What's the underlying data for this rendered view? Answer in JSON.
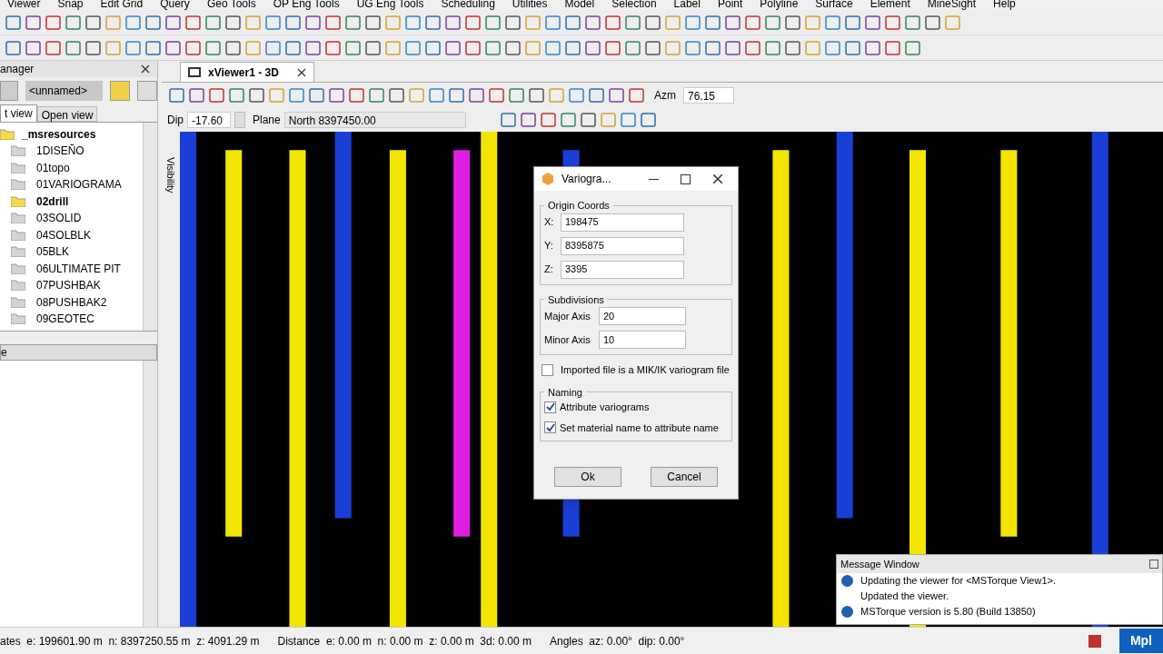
{
  "menu": [
    "Viewer",
    "Snap",
    "Edit Grid",
    "Query",
    "Geo Tools",
    "OP Eng Tools",
    "UG Eng Tools",
    "Scheduling",
    "Utilities",
    "Model",
    "Selection",
    "Label",
    "Point",
    "Polyline",
    "Surface",
    "Element",
    "MineSight",
    "Help"
  ],
  "left_panel": {
    "title": "anager",
    "name_field": {
      "value": "<unnamed>"
    },
    "tabs": [
      {
        "label": "t view",
        "selected": true
      },
      {
        "label": "Open view",
        "selected": false
      }
    ],
    "tree": {
      "label": "_msresources",
      "children": [
        {
          "label": "1DISEÑO",
          "selected": false
        },
        {
          "label": "01topo",
          "selected": false
        },
        {
          "label": "01VARIOGRAMA",
          "selected": false
        },
        {
          "label": "02drill",
          "selected": true
        },
        {
          "label": "03SOLID",
          "selected": false
        },
        {
          "label": "04SOLBLK",
          "selected": false
        },
        {
          "label": "05BLK",
          "selected": false
        },
        {
          "label": "06ULTIMATE PIT",
          "selected": false
        },
        {
          "label": "07PUSHBAK",
          "selected": false
        },
        {
          "label": "08PUSHBAK2",
          "selected": false
        },
        {
          "label": "09GEOTEC",
          "selected": false
        }
      ]
    },
    "lower_header": "e"
  },
  "viewer": {
    "tab": "xViewer1 - 3D",
    "side_tab": "Visibility",
    "azm_label": "Azm",
    "azm": "76.15",
    "dip_label": "Dip",
    "dip": "-17.60",
    "plane_label": "Plane",
    "plane": "North 8397450.00"
  },
  "dialog": {
    "title": "Variogra...",
    "origin": {
      "title": "Origin Coords",
      "fields": [
        {
          "label": "X:",
          "value": "198475"
        },
        {
          "label": "Y:",
          "value": "8395875"
        },
        {
          "label": "Z:",
          "value": "3395"
        }
      ]
    },
    "subdivisions": {
      "title": "Subdivisions",
      "fields": [
        {
          "label": "Major Axis",
          "value": "20"
        },
        {
          "label": "Minor Axis",
          "value": "10"
        }
      ]
    },
    "mik": {
      "label": "Imported file is a MIK/IK variogram file",
      "checked": false
    },
    "naming": {
      "title": "Naming",
      "options": [
        {
          "label": "Attribute variograms",
          "checked": true
        },
        {
          "label": "Set material name to attribute name",
          "checked": true
        }
      ]
    },
    "buttons": [
      "Ok",
      "Cancel"
    ]
  },
  "messages": {
    "title": "Message Window",
    "items": [
      {
        "text": "Updating the viewer for <MSTorque View1>.",
        "info": true
      },
      {
        "text": "Updated the viewer.",
        "info": false
      },
      {
        "text": "MSTorque version is 5.80 (Build 13850)",
        "info": true
      }
    ]
  },
  "status": [
    "ates  e: 199601.90 m  n: 8397250.55 m  z: 4091.29 m",
    "Distance  e: 0.00 m  n: 0.00 m  z: 0.00 m  3d: 0.00 m",
    "Angles  az: 0.00°  dip: 0.00°"
  ],
  "status_badge": "Mpl"
}
